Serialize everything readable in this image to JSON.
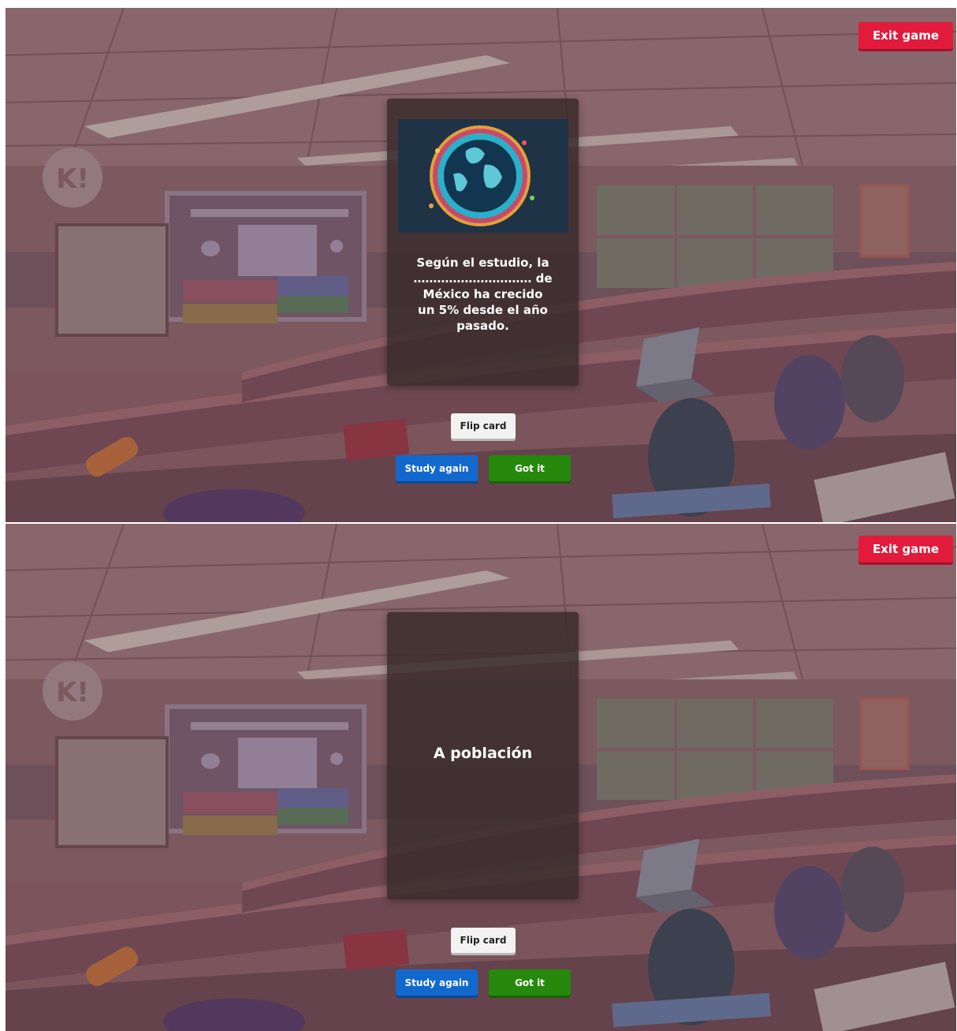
{
  "screens": [
    {
      "exit_label": "Exit game",
      "card": {
        "side": "front",
        "image_icon": "globe-with-people-icon",
        "question_line1": "Según el estudio, la",
        "question_line2": "………………………… de",
        "question_line3": "México ha crecido",
        "question_line4": "un 5% desde el año",
        "question_line5": "pasado."
      },
      "flip_label": "Flip card",
      "study_again_label": "Study again",
      "got_it_label": "Got it"
    },
    {
      "exit_label": "Exit game",
      "card": {
        "side": "back",
        "answer": "A población"
      },
      "flip_label": "Flip card",
      "study_again_label": "Study again",
      "got_it_label": "Got it"
    }
  ],
  "colors": {
    "exit": "#e21b3c",
    "study_again": "#1368ce",
    "got_it": "#26890c",
    "flip": "#f2f2f2"
  }
}
